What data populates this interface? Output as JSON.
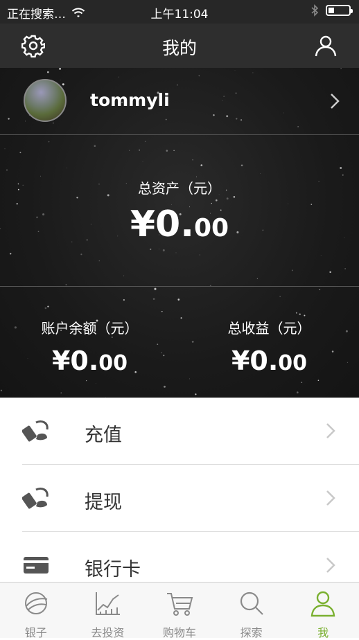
{
  "status_bar": {
    "carrier": "正在搜索…",
    "time": "上午11:04"
  },
  "nav": {
    "title": "我的",
    "left_icon": "gear-icon",
    "right_icon": "user-icon"
  },
  "profile": {
    "username": "tommyli"
  },
  "assets": {
    "total_label": "总资产（元）",
    "total_int": "¥0.",
    "total_dec": "00",
    "balance_label": "账户余额（元）",
    "balance_int": "¥0.",
    "balance_dec": "00",
    "earnings_label": "总收益（元）",
    "earnings_int": "¥0.",
    "earnings_dec": "00"
  },
  "menu": {
    "items": [
      {
        "label": "充值",
        "icon": "recharge-icon"
      },
      {
        "label": "提现",
        "icon": "withdraw-icon"
      },
      {
        "label": "银行卡",
        "icon": "bank-card-icon"
      }
    ]
  },
  "tabs": [
    {
      "label": "银子",
      "icon": "leaf-icon"
    },
    {
      "label": "去投资",
      "icon": "chart-icon"
    },
    {
      "label": "购物车",
      "icon": "cart-icon"
    },
    {
      "label": "探索",
      "icon": "search-icon"
    },
    {
      "label": "我",
      "icon": "person-icon",
      "active": true
    }
  ],
  "colors": {
    "accent": "#7ab030",
    "nav_bg": "#2e2e2e"
  }
}
